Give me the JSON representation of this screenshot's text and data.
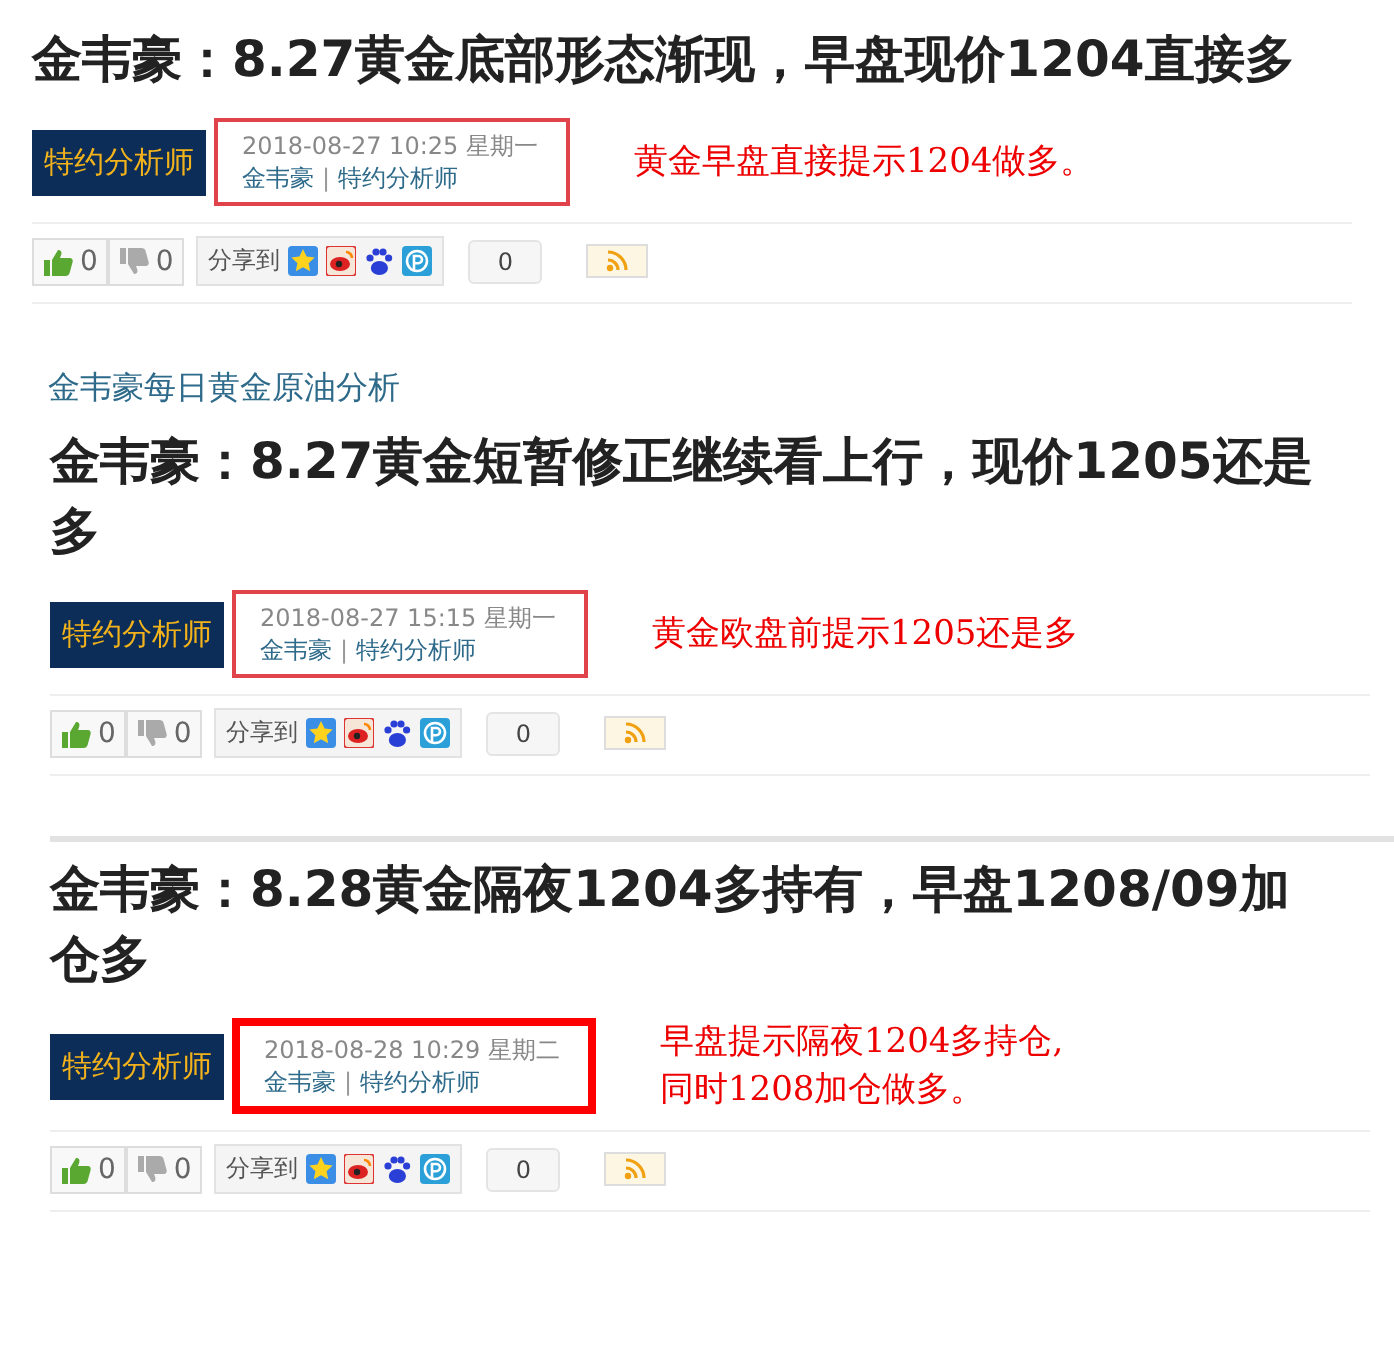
{
  "sections": [
    {
      "kind": "post",
      "title": "金韦豪：8.27黄金底部形态渐现，早盘现价1204直接多",
      "badge": "特约分析师",
      "date": "2018-08-27 10:25 星期一",
      "author": "金韦豪",
      "role": "特约分析师",
      "likes": "0",
      "dislikes": "0",
      "share_label": "分享到",
      "share_count": "0",
      "separator": "|",
      "emphasized": false,
      "note": [
        "黄金早盘直接提示1204做多。"
      ]
    },
    {
      "kind": "link",
      "text": "金韦豪每日黄金原油分析"
    },
    {
      "kind": "post",
      "title": "金韦豪：8.27黄金短暂修正继续看上行，现价1205还是多",
      "badge": "特约分析师",
      "date": "2018-08-27 15:15 星期一",
      "author": "金韦豪",
      "role": "特约分析师",
      "likes": "0",
      "dislikes": "0",
      "share_label": "分享到",
      "share_count": "0",
      "separator": "|",
      "emphasized": false,
      "note": [
        "黄金欧盘前提示1205还是多"
      ]
    },
    {
      "kind": "post",
      "title": "金韦豪：8.28黄金隔夜1204多持有，早盘1208/09加仓多",
      "badge": "特约分析师",
      "date": "2018-08-28 10:29 星期二",
      "author": "金韦豪",
      "role": "特约分析师",
      "likes": "0",
      "dislikes": "0",
      "share_label": "分享到",
      "share_count": "0",
      "separator": "|",
      "emphasized": true,
      "note": [
        "早盘提示隔夜1204多持仓,",
        "同时1208加仓做多。"
      ]
    }
  ]
}
